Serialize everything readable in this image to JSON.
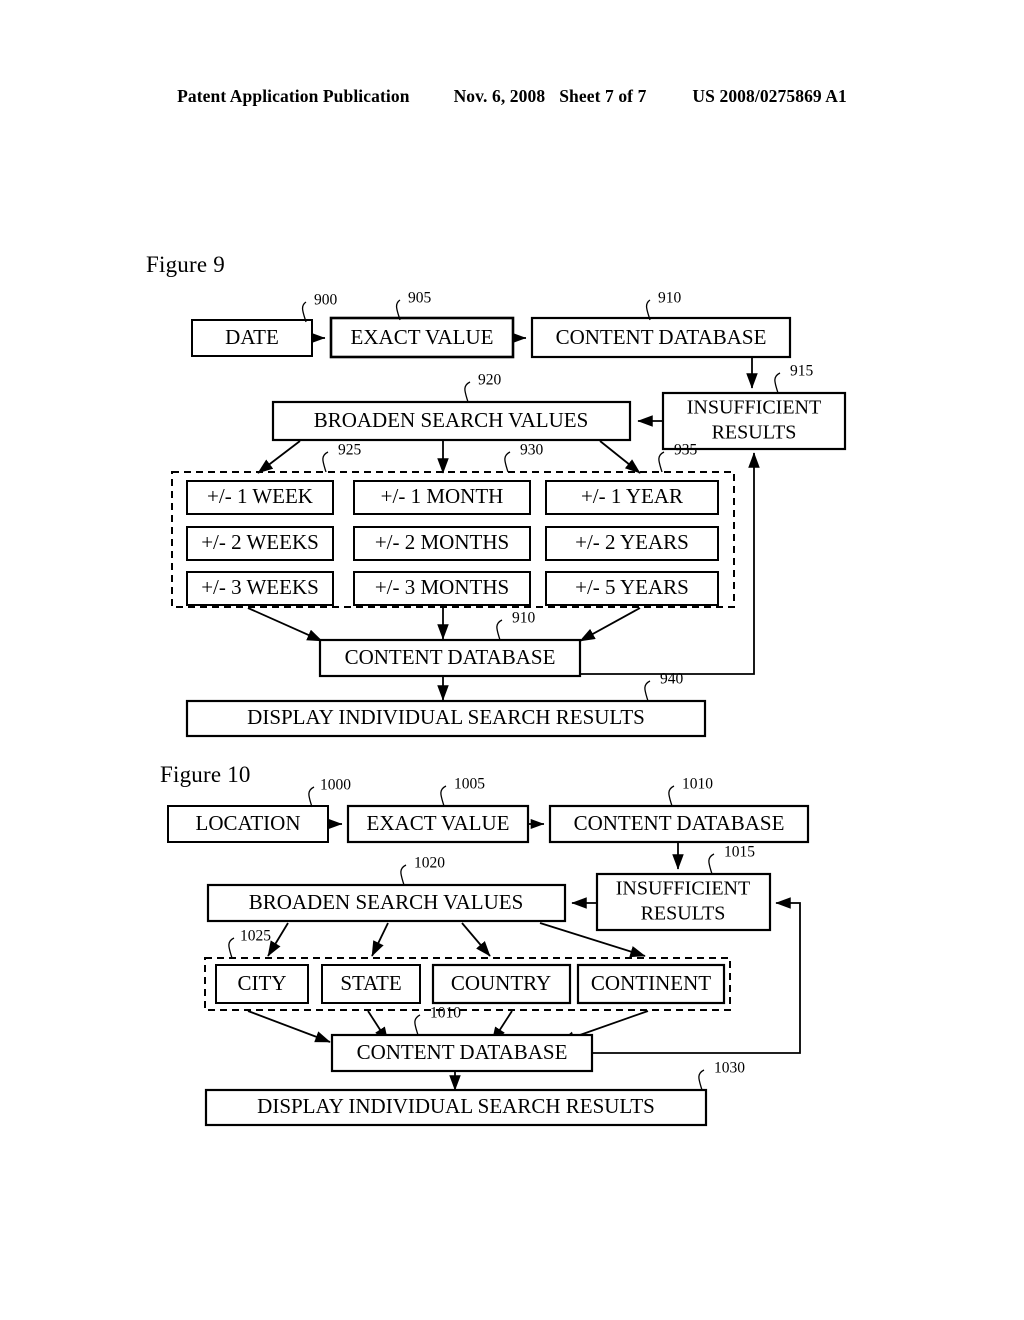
{
  "header": {
    "publication": "Patent Application Publication",
    "date": "Nov. 6, 2008",
    "sheet": "Sheet 7 of 7",
    "patent_number": "US 2008/0275869 A1"
  },
  "figures": [
    {
      "caption": "Figure 9",
      "nodes": {
        "date": {
          "label": "DATE",
          "ref": "900"
        },
        "exact_value": {
          "label": "EXACT VALUE",
          "ref": "905"
        },
        "content_database_top": {
          "label": "CONTENT DATABASE",
          "ref": "910"
        },
        "insufficient_results": {
          "label_line1": "INSUFFICIENT",
          "label_line2": "RESULTS",
          "ref": "915"
        },
        "broaden_search_values": {
          "label": "BROADEN SEARCH VALUES",
          "ref": "920"
        },
        "content_database_bottom": {
          "label": "CONTENT DATABASE",
          "ref": "910"
        },
        "display_results": {
          "label": "DISPLAY INDIVIDUAL SEARCH RESULTS",
          "ref": "940"
        }
      },
      "group_refs": [
        "925",
        "930",
        "935"
      ],
      "broadened_values": [
        [
          "+/- 1 WEEK",
          "+/- 1 MONTH",
          "+/- 1 YEAR"
        ],
        [
          "+/- 2 WEEKS",
          "+/- 2 MONTHS",
          "+/- 2 YEARS"
        ],
        [
          "+/- 3 WEEKS",
          "+/- 3 MONTHS",
          "+/- 5 YEARS"
        ]
      ]
    },
    {
      "caption": "Figure 10",
      "nodes": {
        "location": {
          "label": "LOCATION",
          "ref": "1000"
        },
        "exact_value": {
          "label": "EXACT VALUE",
          "ref": "1005"
        },
        "content_database_top": {
          "label": "CONTENT DATABASE",
          "ref": "1010"
        },
        "insufficient_results": {
          "label_line1": "INSUFFICIENT",
          "label_line2": "RESULTS",
          "ref": "1015"
        },
        "broaden_search_values": {
          "label": "BROADEN SEARCH VALUES",
          "ref": "1020"
        },
        "content_database_bottom": {
          "label": "CONTENT DATABASE",
          "ref": "1010"
        },
        "display_results": {
          "label": "DISPLAY INDIVIDUAL SEARCH RESULTS",
          "ref": "1030"
        }
      },
      "group_refs": [
        "1025"
      ],
      "broadened_values": [
        "CITY",
        "STATE",
        "COUNTRY",
        "CONTINENT"
      ]
    }
  ]
}
